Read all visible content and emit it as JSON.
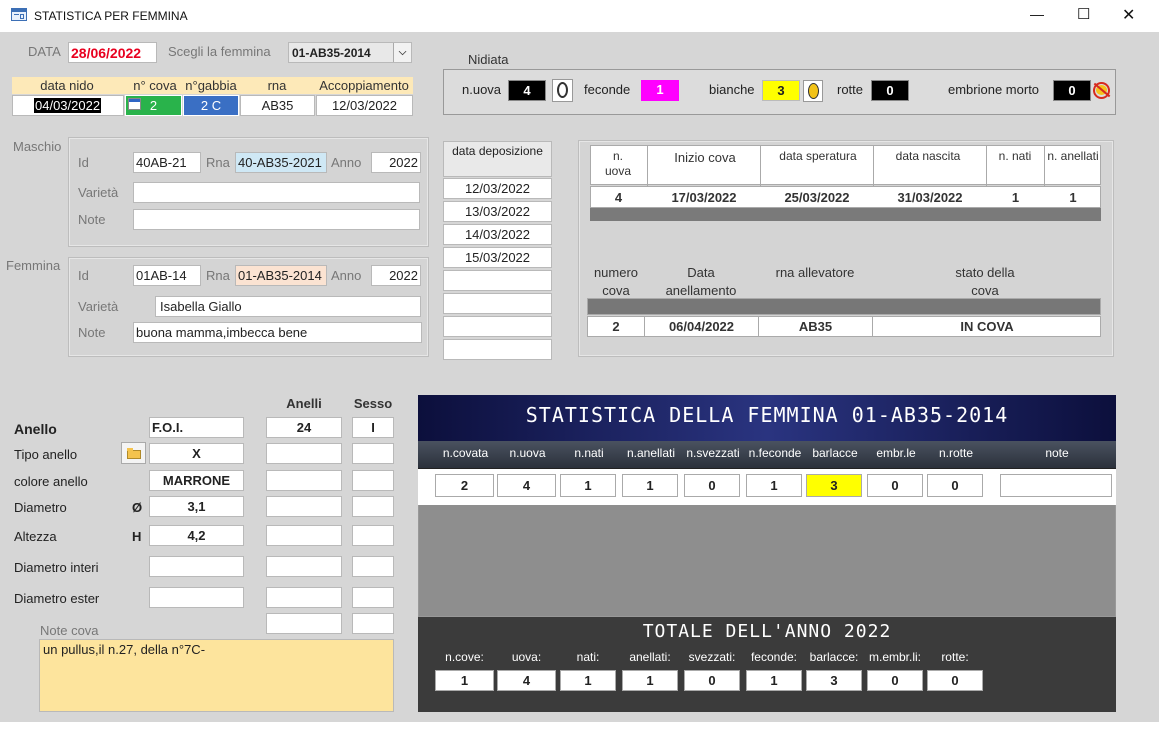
{
  "window": {
    "title": "STATISTICA PER FEMMINA",
    "minimize": "—",
    "maximize": "☐",
    "close": "✕"
  },
  "top": {
    "data_label": "DATA",
    "data_value": "28/06/2022",
    "femmina_label": "Scegli la femmina",
    "femmina_value": "01-AB35-2014"
  },
  "nido": {
    "headers": [
      "data nido",
      "n° cova",
      "n°gabbia",
      "rna",
      "Accoppiamento"
    ],
    "values": [
      "04/03/2022",
      "2",
      "2 C",
      "AB35",
      "12/03/2022"
    ]
  },
  "nidiata": {
    "title": "Nidiata",
    "n_uova_label": "n.uova",
    "n_uova": "4",
    "feconde_label": "feconde",
    "feconde": "1",
    "bianche_label": "bianche",
    "bianche": "3",
    "rotte_label": "rotte",
    "rotte": "0",
    "embrione_label": "embrione morto",
    "embrione": "0"
  },
  "maschio": {
    "section": "Maschio",
    "id_label": "Id",
    "id": "40AB-21",
    "rna_label": "Rna",
    "rna": "40-AB35-2021",
    "anno_label": "Anno",
    "anno": "2022",
    "varieta_label": "Varietà",
    "varieta": "",
    "note_label": "Note",
    "note": ""
  },
  "femmina": {
    "section": "Femmina",
    "id_label": "Id",
    "id": "01AB-14",
    "rna_label": "Rna",
    "rna": "01-AB35-2014",
    "anno_label": "Anno",
    "anno": "2022",
    "varieta_label": "Varietà",
    "varieta": "Isabella  Giallo",
    "note_label": "Note",
    "note": "buona mamma,imbecca bene"
  },
  "deposizione": {
    "header": "data deposizione",
    "dates": [
      "12/03/2022",
      "13/03/2022",
      "14/03/2022",
      "15/03/2022",
      "",
      "",
      "",
      ""
    ]
  },
  "cova_table": {
    "headers": [
      "n. uova",
      "Inizio cova",
      "data speratura",
      "data nascita",
      "n. nati",
      "n. anellati"
    ],
    "values": [
      "4",
      "17/03/2022",
      "25/03/2022",
      "31/03/2022",
      "1",
      "1"
    ]
  },
  "anellamento": {
    "headers": [
      "numero cova",
      "Data anellamento",
      "rna allevatore",
      "stato della cova"
    ],
    "values": [
      "2",
      "06/04/2022",
      "AB35",
      "IN COVA"
    ]
  },
  "anello": {
    "col_anelli": "Anelli",
    "col_sesso": "Sesso",
    "rows": [
      {
        "label": "Anello",
        "prefix": "",
        "value": "F.O.I.",
        "anelli": "24",
        "sesso": "I"
      },
      {
        "label": "Tipo anello",
        "prefix": "",
        "value": "X",
        "anelli": "",
        "sesso": ""
      },
      {
        "label": "colore anello",
        "prefix": "",
        "value": "MARRONE",
        "anelli": "",
        "sesso": ""
      },
      {
        "label": "Diametro",
        "prefix": "Ø",
        "value": "3,1",
        "anelli": "",
        "sesso": ""
      },
      {
        "label": "Altezza",
        "prefix": "H",
        "value": "4,2",
        "anelli": "",
        "sesso": ""
      },
      {
        "label": "Diametro interi",
        "prefix": "",
        "value": "",
        "anelli": "",
        "sesso": ""
      },
      {
        "label": "Diametro ester",
        "prefix": "",
        "value": "",
        "anelli": "",
        "sesso": ""
      }
    ],
    "note_cova_label": "Note cova",
    "note_cova": "un pullus,il n.27, della n°7C-"
  },
  "statistica": {
    "title": "STATISTICA DELLA FEMMINA 01-AB35-2014",
    "headers": [
      "n.covata",
      "n.uova",
      "n.nati",
      "n.anellati",
      "n.svezzati",
      "n.feconde",
      "barlacce",
      "embr.le",
      "n.rotte",
      "note"
    ],
    "values": [
      "2",
      "4",
      "1",
      "1",
      "0",
      "1",
      "3",
      "0",
      "0",
      ""
    ]
  },
  "totale": {
    "title": "TOTALE DELL'ANNO 2022",
    "headers": [
      "n.cove:",
      "uova:",
      "nati:",
      "anellati:",
      "svezzati:",
      "feconde:",
      "barlacce:",
      "m.embr.li:",
      "rotte:"
    ],
    "values": [
      "1",
      "4",
      "1",
      "1",
      "0",
      "1",
      "3",
      "0",
      "0"
    ]
  },
  "colors": {
    "red_date": "#e8001f",
    "green": "#29b34b",
    "blue": "#3a6fc4",
    "magenta": "#ff00ff",
    "yellow": "#ffff00",
    "dark_panel": "#3b3b3b",
    "navy": "#1b1f5e"
  }
}
